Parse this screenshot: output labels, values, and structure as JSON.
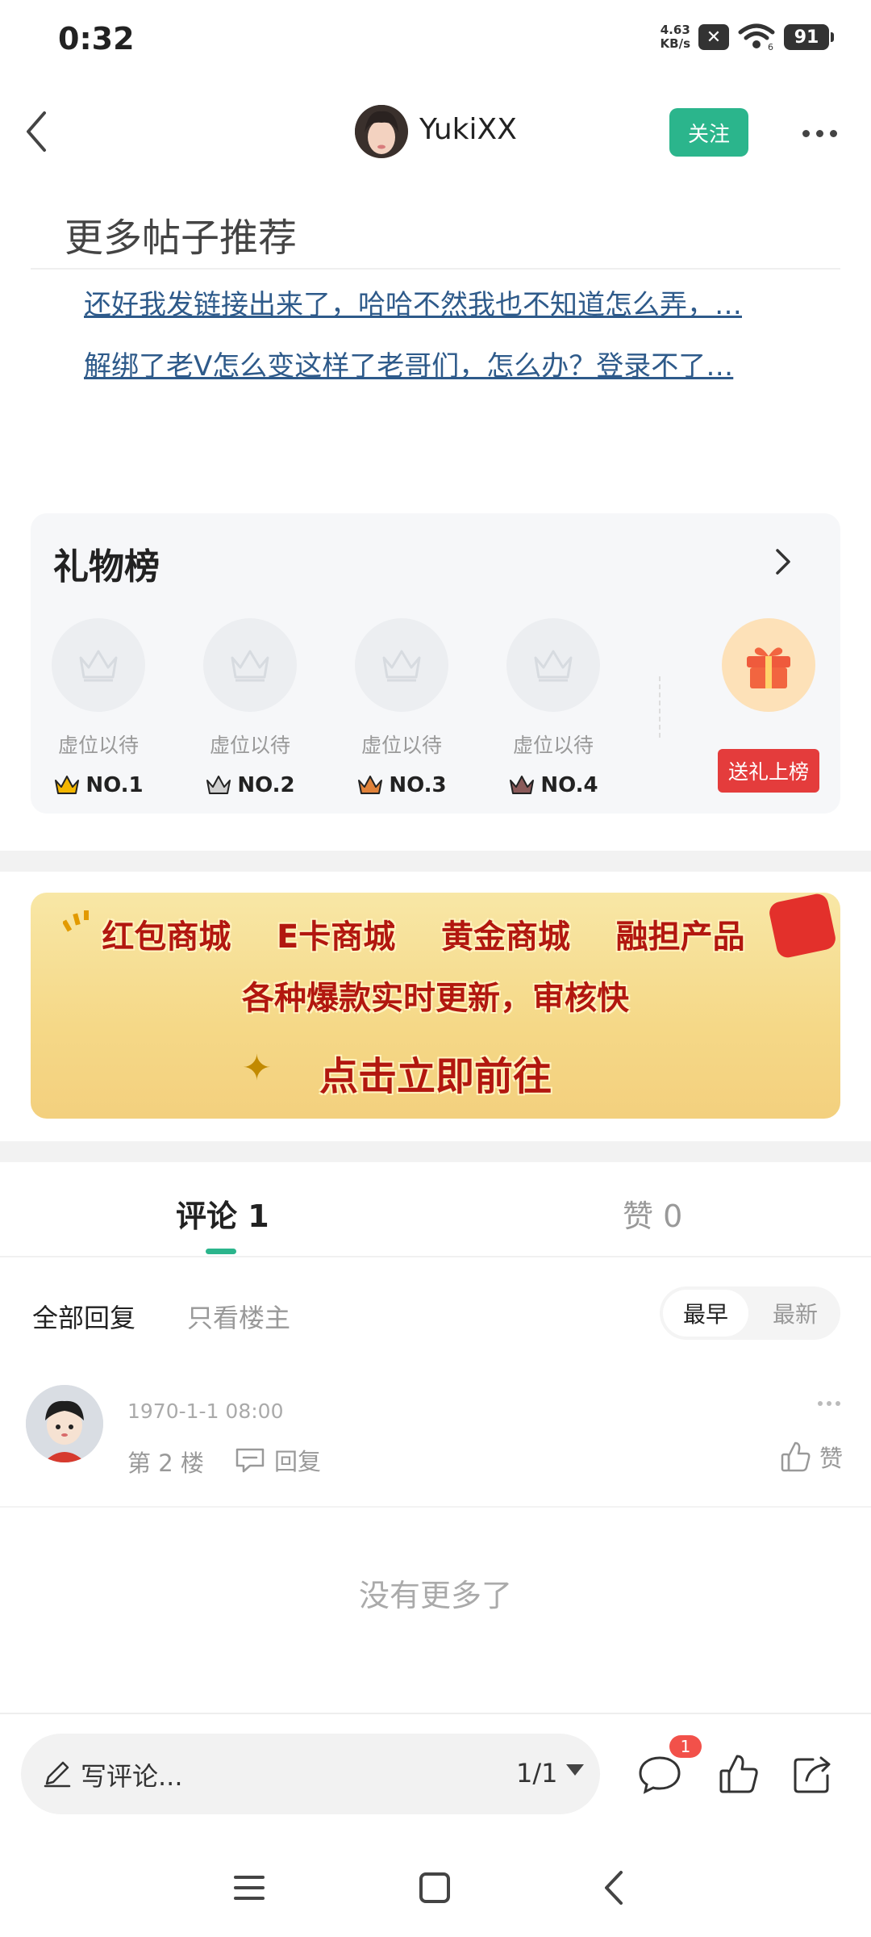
{
  "status_bar": {
    "time": "0:32",
    "net_speed_value": "4.63",
    "net_speed_unit": "KB/s",
    "signal_badge": "6",
    "battery": "91"
  },
  "header": {
    "user_name": "YukiXX",
    "follow_label": "关注"
  },
  "recommendations": {
    "title": "更多帖子推荐",
    "items": [
      "还好我发链接出来了，哈哈不然我也不知道怎么弄，…",
      "解绑了老V怎么变这样了老哥们，怎么办？登录不了…"
    ]
  },
  "gift_board": {
    "title": "礼物榜",
    "slots": [
      {
        "label": "虚位以待",
        "rank": "NO.1",
        "crown_color": "#f3b600"
      },
      {
        "label": "虚位以待",
        "rank": "NO.2",
        "crown_color": "#cfcfcf"
      },
      {
        "label": "虚位以待",
        "rank": "NO.3",
        "crown_color": "#e0823a"
      },
      {
        "label": "虚位以待",
        "rank": "NO.4",
        "crown_color": "#8a5a5a"
      }
    ],
    "send_label": "送礼上榜"
  },
  "banner": {
    "items": [
      "红包商城",
      "E卡商城",
      "黄金商城",
      "融担产品"
    ],
    "line2": "各种爆款实时更新，审核快",
    "cta": "点击立即前往"
  },
  "tabs": {
    "comments": "评论 1",
    "likes": "赞 0"
  },
  "filters": {
    "all": "全部回复",
    "host_only": "只看楼主",
    "earliest": "最早",
    "latest": "最新"
  },
  "comment": {
    "time": "1970-1-1 08:00",
    "floor": "第 2 楼",
    "reply_label": "回复",
    "like_label": "赞"
  },
  "no_more": "没有更多了",
  "bottom_bar": {
    "placeholder": "写评论...",
    "page": "1/1",
    "comment_badge": "1"
  },
  "colors": {
    "accent": "#2bb58c",
    "link": "#2e5a8a",
    "danger": "#e43c3c"
  }
}
